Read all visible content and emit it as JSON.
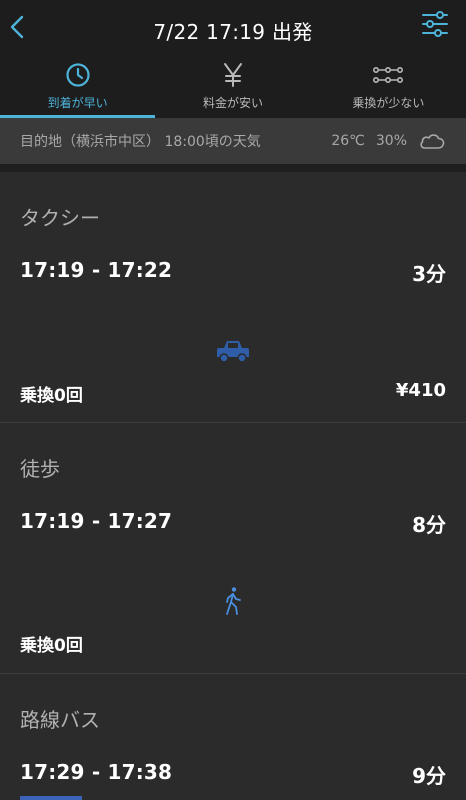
{
  "header": {
    "title": "7/22 17:19 出発",
    "back_icon": "chevron-left-icon",
    "filter_icon": "sliders-icon"
  },
  "tabs": [
    {
      "label": "到着が早い",
      "icon": "clock-icon",
      "active": true
    },
    {
      "label": "料金が安い",
      "icon": "yen-icon",
      "active": false
    },
    {
      "label": "乗換が少ない",
      "icon": "route-nodes-icon",
      "active": false
    }
  ],
  "weather": {
    "location_text": "目的地（横浜市中区） 18:00頃の天気",
    "temperature": "26℃",
    "precipitation": "30%",
    "icon": "cloud-icon"
  },
  "routes": [
    {
      "mode": "タクシー",
      "time_range": "17:19 - 17:22",
      "duration": "3分",
      "icon": "taxi-icon",
      "transfers": "乗換0回",
      "fare": "¥410"
    },
    {
      "mode": "徒歩",
      "time_range": "17:19 - 17:27",
      "duration": "8分",
      "icon": "walking-icon",
      "transfers": "乗換0回",
      "fare": ""
    },
    {
      "mode": "路線バス",
      "time_range": "17:29 - 17:38",
      "duration": "9分",
      "icon": "bus-icon",
      "transfers": "",
      "fare": ""
    }
  ],
  "colors": {
    "accent": "#4db3d9",
    "background": "#2b2b2b",
    "header_bg": "#1d1d1d",
    "taxi_icon": "#2f5da8",
    "walk_icon": "#4a8fe0"
  }
}
